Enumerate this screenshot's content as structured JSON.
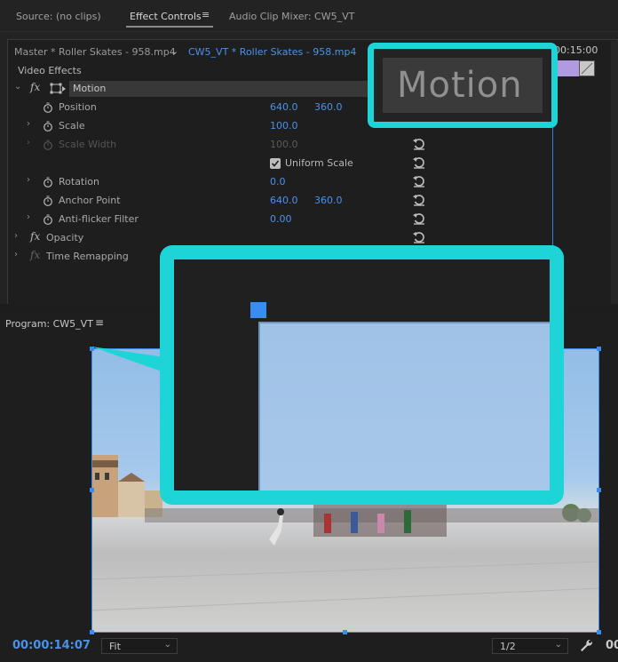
{
  "tabs": {
    "source": "Source: (no clips)",
    "effect_controls": "Effect Controls",
    "audio_mixer": "Audio Clip Mixer: CW5_VT"
  },
  "effect_controls": {
    "master_clip": "Master * Roller Skates - 958.mp4",
    "sequence_clip": "CW5_VT * Roller Skates - 958.mp4",
    "timeline_timecode": "00:15:00",
    "section_label": "Video Effects",
    "motion": {
      "label": "Motion",
      "position": {
        "label": "Position",
        "x": "640.0",
        "y": "360.0"
      },
      "scale": {
        "label": "Scale",
        "value": "100.0"
      },
      "scale_width": {
        "label": "Scale Width",
        "value": "100.0"
      },
      "uniform_scale": {
        "label": "Uniform Scale",
        "checked": true
      },
      "rotation": {
        "label": "Rotation",
        "value": "0.0"
      },
      "anchor_point": {
        "label": "Anchor Point",
        "x": "640.0",
        "y": "360.0"
      },
      "anti_flicker": {
        "label": "Anti-flicker Filter",
        "value": "0.00"
      }
    },
    "opacity_label": "Opacity",
    "time_remapping_label": "Time Remapping"
  },
  "program_monitor": {
    "title": "Program: CW5_VT",
    "timecode": "00:00:14:07",
    "fit_select": "Fit",
    "resolution_select": "1/2",
    "right_timecode_partial": "00"
  },
  "callouts": {
    "motion_zoom_text": "Motion"
  },
  "colors": {
    "accent_blue": "#4a92e8",
    "callout_cyan": "#1dd4d6",
    "handle_blue": "#3b8cf0"
  }
}
